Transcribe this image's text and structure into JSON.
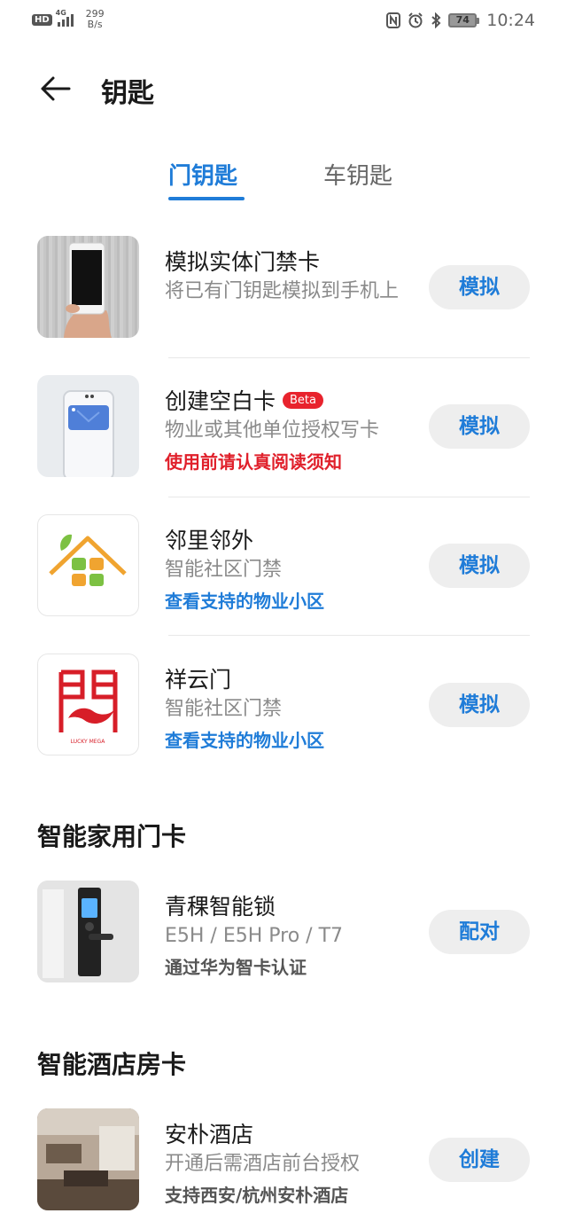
{
  "status_bar": {
    "hd": "HD",
    "network": "4G",
    "speed_value": "299",
    "speed_unit": "B/s",
    "battery": "74",
    "time": "10:24",
    "icons": [
      "nfc-icon",
      "alarm-icon",
      "bluetooth-icon"
    ]
  },
  "header": {
    "title": "钥匙"
  },
  "tabs": [
    {
      "label": "门钥匙",
      "active": true
    },
    {
      "label": "车钥匙",
      "active": false
    }
  ],
  "door_keys": [
    {
      "title": "模拟实体门禁卡",
      "subtitle": "将已有门钥匙模拟到手机上",
      "link": "",
      "action": "模拟"
    },
    {
      "title": "创建空白卡",
      "badge": "Beta",
      "subtitle": "物业或其他单位授权写卡",
      "link": "使用前请认真阅读须知",
      "action": "模拟"
    },
    {
      "title": "邻里邻外",
      "subtitle": "智能社区门禁",
      "link": "查看支持的物业小区",
      "action": "模拟"
    },
    {
      "title": "祥云门",
      "subtitle": "智能社区门禁",
      "link": "查看支持的物业小区",
      "action": "模拟"
    }
  ],
  "smart_home": {
    "section_title": "智能家用门卡",
    "item": {
      "title": "青稞智能锁",
      "subtitle": "E5H / E5H Pro / T7",
      "link": "通过华为智卡认证",
      "action": "配对"
    }
  },
  "smart_hotel": {
    "section_title": "智能酒店房卡",
    "item": {
      "title": "安朴酒店",
      "subtitle": "开通后需酒店前台授权",
      "link": "支持西安/杭州安朴酒店",
      "action": "创建"
    }
  },
  "logo_text": {
    "xiangyun": "LUCKY MEGA"
  },
  "colors": {
    "accent": "#1f7cd8",
    "warning": "#e0202b",
    "button_bg": "#eeeeee"
  }
}
